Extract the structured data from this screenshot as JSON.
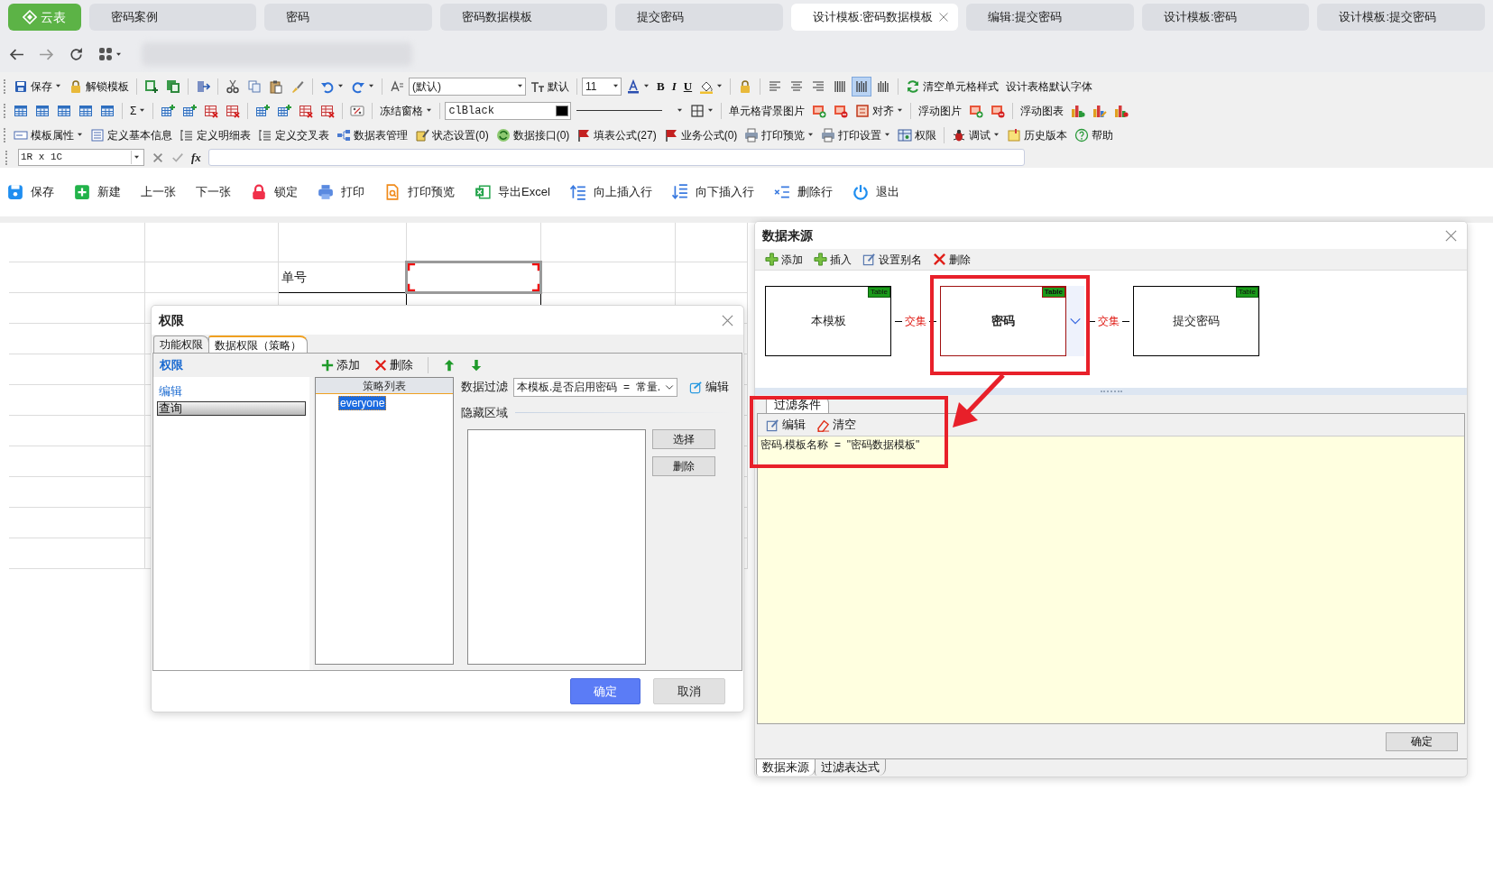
{
  "tabs": [
    {
      "kind": "brand",
      "label": "云表",
      "selected": false
    },
    {
      "kind": "page",
      "label": "密码案例",
      "selected": false
    },
    {
      "kind": "page",
      "label": "密码",
      "selected": false
    },
    {
      "kind": "page",
      "label": "密码数据模板",
      "selected": false
    },
    {
      "kind": "page",
      "label": "提交密码",
      "selected": false
    },
    {
      "kind": "page",
      "label": "设计模板:密码数据模板",
      "selected": true
    },
    {
      "kind": "page",
      "label": "编辑:提交密码",
      "selected": false
    },
    {
      "kind": "page",
      "label": "设计模板:密码",
      "selected": false
    },
    {
      "kind": "page",
      "label": "设计模板:提交密码",
      "selected": false
    }
  ],
  "toolbar_rows": [
    [
      {
        "kind": "icon-text",
        "label": "保存",
        "dropdown": true
      },
      {
        "kind": "icon-text",
        "label": "解锁模板"
      },
      {
        "kind": "separator"
      },
      {
        "kind": "icon"
      },
      {
        "kind": "icon"
      },
      {
        "kind": "separator"
      },
      {
        "kind": "icon"
      },
      {
        "kind": "separator"
      },
      {
        "kind": "icon"
      },
      {
        "kind": "icon"
      },
      {
        "kind": "icon"
      },
      {
        "kind": "icon"
      },
      {
        "kind": "separator"
      },
      {
        "kind": "icon",
        "dropdown": true
      },
      {
        "kind": "icon",
        "dropdown": true
      },
      {
        "kind": "separator"
      },
      {
        "kind": "icon"
      },
      {
        "kind": "select",
        "value": "(默认)"
      },
      {
        "kind": "icon-text",
        "label": "默认"
      },
      {
        "kind": "separator"
      },
      {
        "kind": "select",
        "value": "11"
      },
      {
        "kind": "icon",
        "dropdown": true
      },
      {
        "kind": "format",
        "label": "B"
      },
      {
        "kind": "format",
        "label": "I"
      },
      {
        "kind": "format",
        "label": "U"
      },
      {
        "kind": "icon",
        "dropdown": true
      },
      {
        "kind": "separator"
      },
      {
        "kind": "icon"
      },
      {
        "kind": "separator"
      },
      {
        "kind": "toggle",
        "selected": false
      },
      {
        "kind": "toggle",
        "selected": false
      },
      {
        "kind": "toggle",
        "selected": false
      },
      {
        "kind": "toggle",
        "selected": false
      },
      {
        "kind": "toggle",
        "selected": true
      },
      {
        "kind": "toggle",
        "selected": false
      },
      {
        "kind": "separator"
      },
      {
        "kind": "icon-text",
        "label": "清空单元格样式"
      },
      {
        "kind": "text",
        "label": "设计表格默认字体"
      }
    ],
    [
      {
        "kind": "icon"
      },
      {
        "kind": "icon"
      },
      {
        "kind": "icon"
      },
      {
        "kind": "icon"
      },
      {
        "kind": "icon"
      },
      {
        "kind": "separator"
      },
      {
        "kind": "text",
        "label": "Σ",
        "dropdown": true
      },
      {
        "kind": "separator"
      },
      {
        "kind": "icon"
      },
      {
        "kind": "icon"
      },
      {
        "kind": "icon"
      },
      {
        "kind": "icon"
      },
      {
        "kind": "separator"
      },
      {
        "kind": "icon"
      },
      {
        "kind": "icon"
      },
      {
        "kind": "icon"
      },
      {
        "kind": "icon"
      },
      {
        "kind": "separator"
      },
      {
        "kind": "icon"
      },
      {
        "kind": "separator"
      },
      {
        "kind": "text",
        "label": "冻结窗格",
        "dropdown": true
      },
      {
        "kind": "separator"
      },
      {
        "kind": "color-select",
        "value": "clBlack",
        "color": "#000000"
      },
      {
        "kind": "line-select"
      },
      {
        "kind": "icon",
        "dropdown": true
      },
      {
        "kind": "separator"
      },
      {
        "kind": "text",
        "label": "单元格背景图片"
      },
      {
        "kind": "icon"
      },
      {
        "kind": "icon"
      },
      {
        "kind": "icon-text",
        "label": "对齐",
        "dropdown": true
      },
      {
        "kind": "separator"
      },
      {
        "kind": "text",
        "label": "浮动图片"
      },
      {
        "kind": "icon"
      },
      {
        "kind": "icon"
      },
      {
        "kind": "separator"
      },
      {
        "kind": "text",
        "label": "浮动图表"
      },
      {
        "kind": "icon"
      },
      {
        "kind": "icon"
      },
      {
        "kind": "icon"
      }
    ],
    [
      {
        "kind": "icon-text",
        "label": "模板属性",
        "dropdown": true
      },
      {
        "kind": "icon-text",
        "label": "定义基本信息"
      },
      {
        "kind": "icon-text",
        "label": "定义明细表"
      },
      {
        "kind": "icon-text",
        "label": "定义交叉表"
      },
      {
        "kind": "icon-text",
        "label": "数据表管理"
      },
      {
        "kind": "icon-text",
        "label": "状态设置(0)"
      },
      {
        "kind": "icon-text",
        "label": "数据接口(0)"
      },
      {
        "kind": "icon-text",
        "label": "填表公式(27)"
      },
      {
        "kind": "icon-text",
        "label": "业务公式(0)"
      },
      {
        "kind": "icon-text",
        "label": "打印预览",
        "dropdown": true
      },
      {
        "kind": "icon-text",
        "label": "打印设置",
        "dropdown": true
      },
      {
        "kind": "icon-text",
        "label": "权限"
      },
      {
        "kind": "separator"
      },
      {
        "kind": "icon-text",
        "label": "调试",
        "dropdown": true
      },
      {
        "kind": "icon-text",
        "label": "历史版本"
      },
      {
        "kind": "icon-text",
        "label": "帮助"
      }
    ]
  ],
  "formula_bar": {
    "cell_ref": "1R x 1C",
    "function_label": "fx"
  },
  "actions": [
    {
      "kind": "icon-text",
      "label": "保存"
    },
    {
      "kind": "icon-text",
      "label": "新建"
    },
    {
      "kind": "text",
      "label": "上一张"
    },
    {
      "kind": "text",
      "label": "下一张"
    },
    {
      "kind": "icon-text",
      "label": "锁定"
    },
    {
      "kind": "icon-text",
      "label": "打印"
    },
    {
      "kind": "icon-text",
      "label": "打印预览"
    },
    {
      "kind": "icon-text",
      "label": "导出Excel"
    },
    {
      "kind": "icon-text",
      "label": "向上插入行"
    },
    {
      "kind": "icon-text",
      "label": "向下插入行"
    },
    {
      "kind": "icon-text",
      "label": "删除行"
    },
    {
      "kind": "icon-text",
      "label": "退出"
    }
  ],
  "sheet": {
    "cells": [
      {
        "text": "单号",
        "selected": false
      },
      {
        "selected": true
      }
    ]
  },
  "permission_dialog": {
    "title": "权限",
    "tabs": [
      {
        "label": "功能权限",
        "selected": false
      },
      {
        "label": "数据权限（策略）",
        "selected": true
      }
    ],
    "panel_title": "权限",
    "permissions": [
      {
        "label": "编辑",
        "selected": false
      },
      {
        "label": "查询",
        "selected": true
      }
    ],
    "toolbar": [
      {
        "kind": "add",
        "label": "添加"
      },
      {
        "kind": "delete",
        "label": "删除"
      },
      {
        "kind": "up"
      },
      {
        "kind": "down"
      }
    ],
    "policy_header": "策略列表",
    "policies": [
      {
        "label": "everyone",
        "selected": true
      }
    ],
    "filter_label": "数据过滤",
    "filter_value": "本模板.是否启用密码  =  常量.",
    "edit_label": "编辑",
    "hidden_label": "隐藏区域",
    "side_buttons": [
      "选择",
      "删除"
    ],
    "ok": "确定",
    "cancel": "取消"
  },
  "datasource_dialog": {
    "title": "数据来源",
    "toolbar": [
      {
        "kind": "add",
        "label": "添加"
      },
      {
        "kind": "add",
        "label": "插入"
      },
      {
        "kind": "edit",
        "label": "设置别名"
      },
      {
        "kind": "delete",
        "label": "删除"
      }
    ],
    "nodes": [
      {
        "label": "本模板",
        "tag": "Table",
        "selected": false
      },
      {
        "label": "密码",
        "tag": "Table",
        "selected": true
      },
      {
        "label": "提交密码",
        "tag": "Table",
        "selected": false
      }
    ],
    "joins": [
      "交集",
      "交集"
    ],
    "filter_tab": "过滤条件",
    "filter_tools": [
      {
        "kind": "edit",
        "label": "编辑"
      },
      {
        "kind": "clear",
        "label": "清空"
      }
    ],
    "condition": "密码.模板名称  =  \"密码数据模板\"",
    "ok": "确定",
    "bottom_tabs": [
      {
        "label": "数据来源",
        "selected": true
      },
      {
        "label": "过滤表达式",
        "selected": false
      }
    ]
  }
}
